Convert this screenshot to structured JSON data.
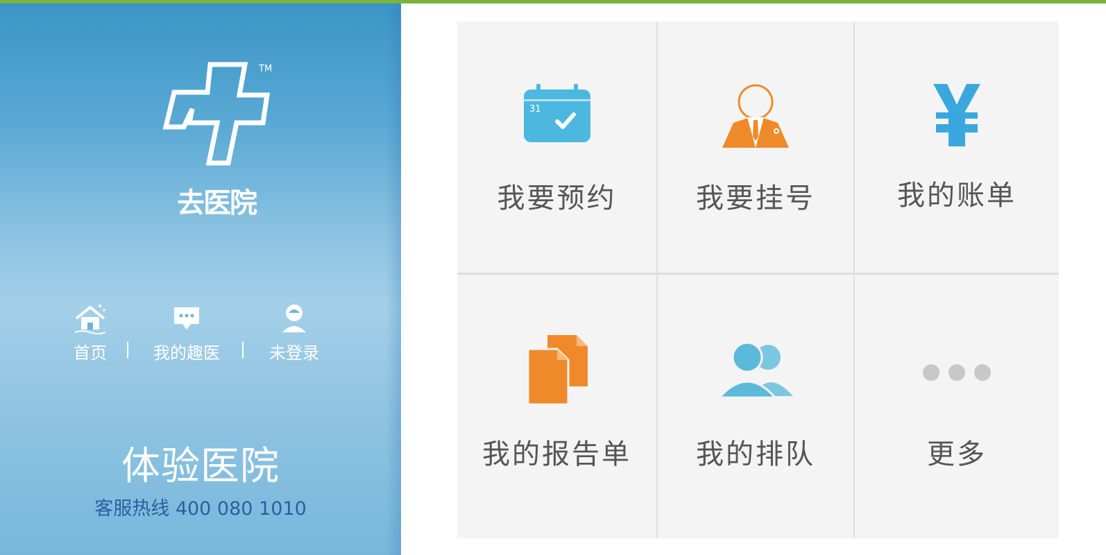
{
  "brand": {
    "logo_text": "去医院",
    "trademark": "TM",
    "accent_color": "#7cb33b"
  },
  "nav": {
    "items": [
      {
        "label": "首页",
        "icon": "home-icon"
      },
      {
        "label": "我的趣医",
        "icon": "chat-icon"
      },
      {
        "label": "未登录",
        "icon": "user-icon"
      }
    ],
    "separator": "|"
  },
  "hospital": {
    "name": "体验医院",
    "hotline": "客服热线 400 080 1010"
  },
  "menu": [
    {
      "label": "我要预约",
      "icon": "calendar-icon",
      "color": "#4cb8df"
    },
    {
      "label": "我要挂号",
      "icon": "doctor-icon",
      "color": "#ef8a2b"
    },
    {
      "label": "我的账单",
      "icon": "yen-icon",
      "color": "#3aa8df"
    },
    {
      "label": "我的报告单",
      "icon": "documents-icon",
      "color": "#ef8a2b"
    },
    {
      "label": "我的排队",
      "icon": "queue-icon",
      "color": "#5bbad9"
    },
    {
      "label": "更多",
      "icon": "more-icon",
      "color": "#c8c8c8"
    }
  ],
  "calendar_day": "31"
}
